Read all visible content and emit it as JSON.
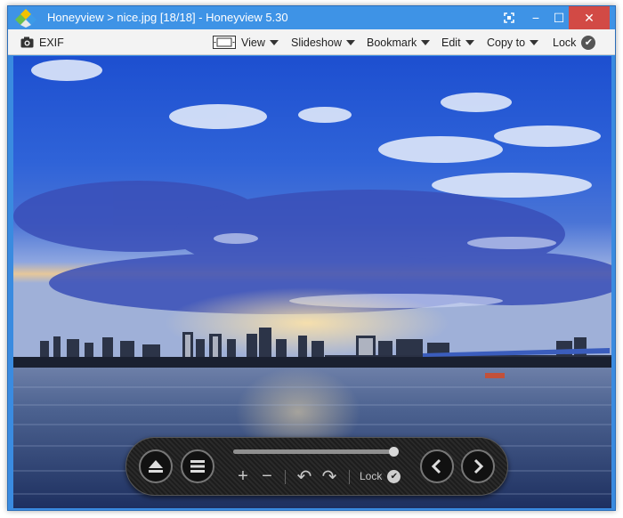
{
  "window": {
    "title": "Honeyview  >  nice.jpg  [18/18]  -  Honeyview  5.30"
  },
  "titlebar_buttons": {
    "fullscreen_icon": "fullscreen-icon",
    "minimize_glyph": "−",
    "maximize_glyph": "☐",
    "close_glyph": "✕",
    "close_color": "#d24a45"
  },
  "toolbar": {
    "exif_label": "EXIF",
    "view_label": "View",
    "slideshow_label": "Slideshow",
    "bookmark_label": "Bookmark",
    "edit_label": "Edit",
    "copyto_label": "Copy to",
    "lock_label": "Lock",
    "check_glyph": "✔"
  },
  "control_panel": {
    "zoom_in_glyph": "+",
    "zoom_out_glyph": "−",
    "rotate_left_glyph": "↶",
    "rotate_right_glyph": "↷",
    "lock_label": "Lock",
    "check_glyph": "✔",
    "position_fraction": 1.0
  },
  "colors": {
    "titlebar": "#3e93e6",
    "toolbar": "#f3f3f3",
    "panel": "#1f1f1f"
  }
}
